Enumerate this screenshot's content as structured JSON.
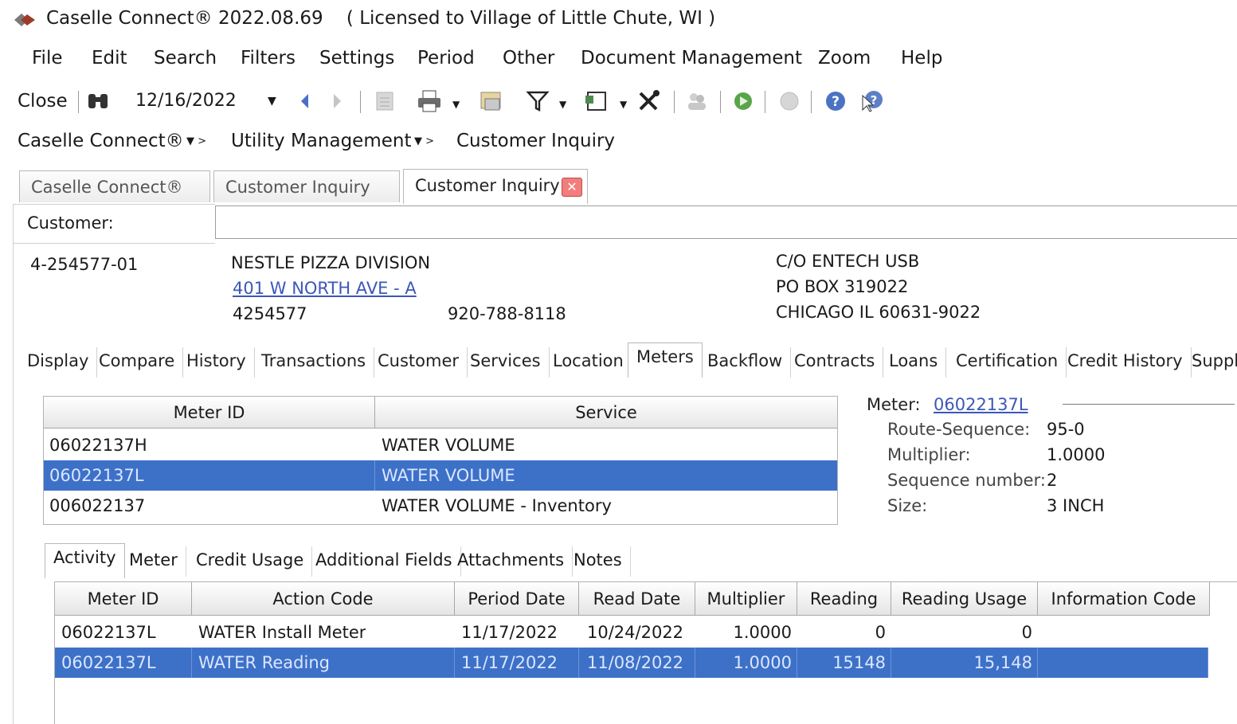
{
  "window": {
    "app_name": "Caselle Connect®",
    "version": "2022.08.69",
    "license": "( Licensed to Village of Little Chute, WI )"
  },
  "menu": [
    "File",
    "Edit",
    "Search",
    "Filters",
    "Settings",
    "Period",
    "Other",
    "Document Management",
    "Zoom",
    "Help"
  ],
  "toolbar": {
    "close_label": "Close",
    "date": "12/16/2022"
  },
  "breadcrumb": [
    "Caselle Connect®",
    "Utility Management",
    "Customer Inquiry"
  ],
  "doc_tabs": [
    "Caselle Connect®",
    "Customer Inquiry",
    "Customer Inquiry"
  ],
  "customer": {
    "label": "Customer:",
    "input_value": "",
    "account": "4-254577-01",
    "name": "NESTLE PIZZA DIVISION",
    "service_address": "401 W NORTH AVE - A",
    "id_number": "4254577",
    "phone": "920-788-8118",
    "mailing": [
      "C/O ENTECH USB",
      "PO BOX 319022",
      "CHICAGO IL 60631-9022"
    ]
  },
  "section_tabs": [
    "Display",
    "Compare",
    "History",
    "Transactions",
    "Customer",
    "Services",
    "Location",
    "Meters",
    "Backflow",
    "Contracts",
    "Loans",
    "Certification",
    "Credit History",
    "Suppl"
  ],
  "meter_table": {
    "columns": [
      "Meter ID",
      "Service"
    ],
    "rows": [
      {
        "meter_id": "06022137H",
        "service": "WATER VOLUME"
      },
      {
        "meter_id": "06022137L",
        "service": "WATER VOLUME"
      },
      {
        "meter_id": "006022137",
        "service": "WATER VOLUME - Inventory"
      }
    ],
    "selected_index": 1
  },
  "meter_details": {
    "meter_label": "Meter:",
    "meter_value": "06022137L",
    "route_label": "Route-Sequence:",
    "route_value": "95-0",
    "multiplier_label": "Multiplier:",
    "multiplier_value": "1.0000",
    "sequence_label": "Sequence number:",
    "sequence_value": "2",
    "size_label": "Size:",
    "size_value": "3 INCH"
  },
  "sub_tabs": [
    "Activity",
    "Meter",
    "Credit Usage",
    "Additional Fields",
    "Attachments",
    "Notes"
  ],
  "activity_table": {
    "columns": [
      "Meter ID",
      "Action Code",
      "Period Date",
      "Read Date",
      "Multiplier",
      "Reading",
      "Reading Usage",
      "Information Code"
    ],
    "rows": [
      {
        "meter_id": "06022137L",
        "action": "WATER Install Meter",
        "period": "11/17/2022",
        "read": "10/24/2022",
        "multiplier": "1.0000",
        "reading": "0",
        "usage": "0",
        "info": ""
      },
      {
        "meter_id": "06022137L",
        "action": "WATER Reading",
        "period": "11/17/2022",
        "read": "11/08/2022",
        "multiplier": "1.0000",
        "reading": "15148",
        "usage": "15,148",
        "info": ""
      }
    ],
    "selected_index": 1
  },
  "colors": {
    "selection": "#3d71c8",
    "link": "#3c57b9",
    "close_tab": "#f27d7d"
  }
}
